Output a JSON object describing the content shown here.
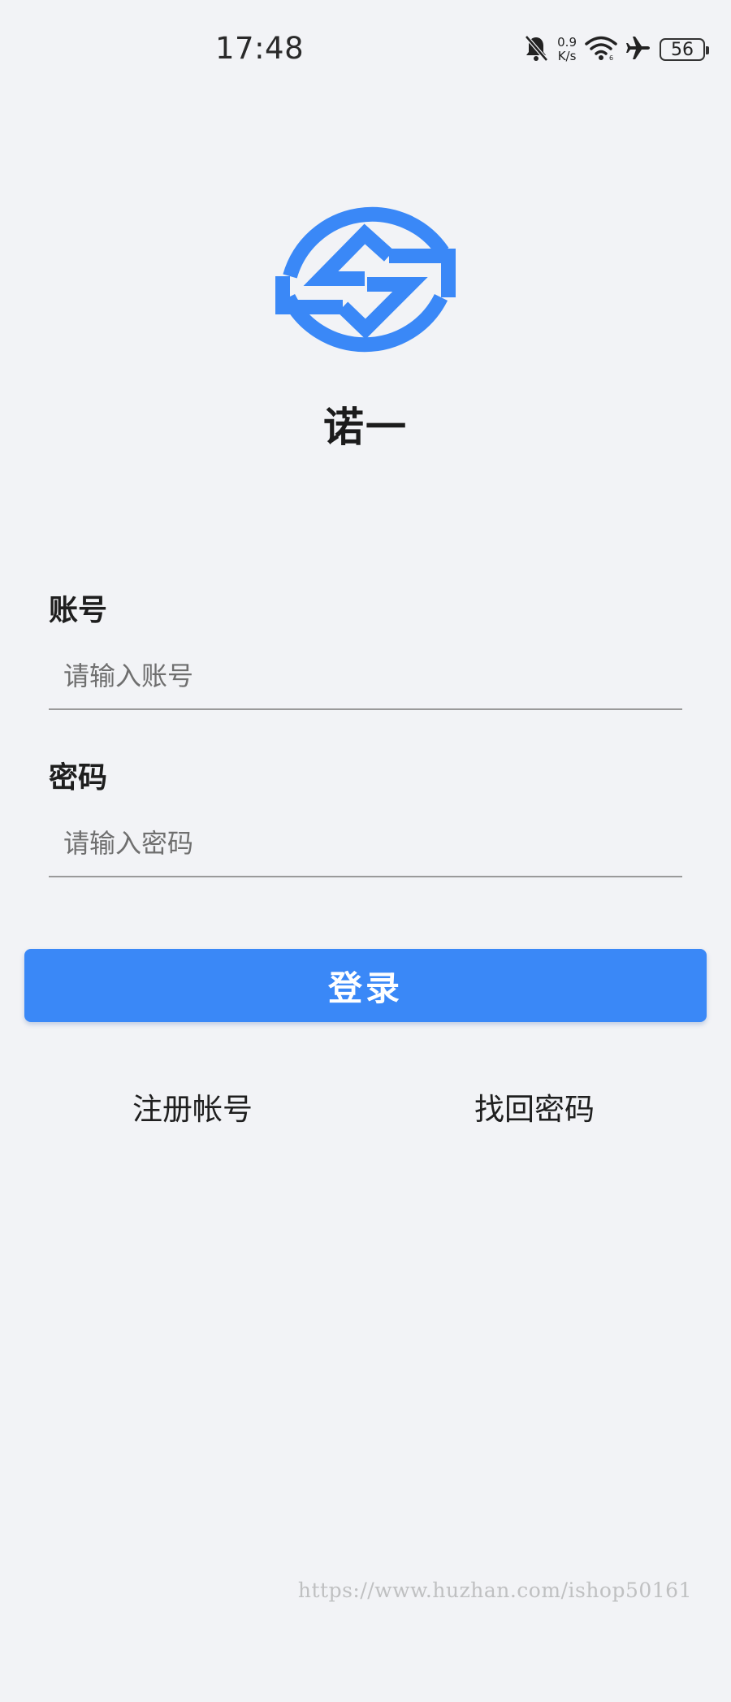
{
  "status_bar": {
    "time": "17:48",
    "net_speed_value": "0.9",
    "net_speed_unit": "K/s",
    "battery_level": "56",
    "icons": [
      "bell-off-icon",
      "wifi-icon",
      "airplane-icon",
      "battery-icon"
    ]
  },
  "brand": {
    "name": "诺一",
    "logo_color": "#3a88f7"
  },
  "form": {
    "account": {
      "label": "账号",
      "placeholder": "请输入账号",
      "value": ""
    },
    "password": {
      "label": "密码",
      "placeholder": "请输入密码",
      "value": ""
    },
    "login_label": "登录"
  },
  "links": {
    "register": "注册帐号",
    "recover": "找回密码"
  },
  "watermark": "https://www.huzhan.com/ishop50161",
  "colors": {
    "accent": "#3a88f7",
    "background": "#f2f3f6"
  }
}
